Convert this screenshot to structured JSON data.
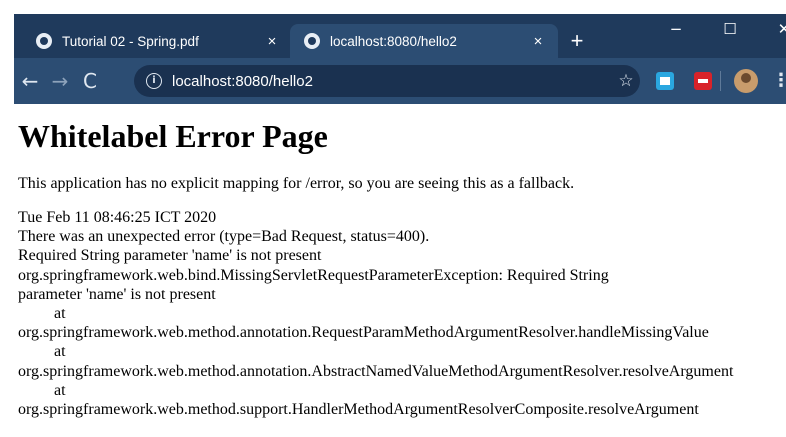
{
  "browser": {
    "tabs": [
      {
        "title": "Tutorial 02 - Spring.pdf",
        "close": "×",
        "active": false
      },
      {
        "title": "localhost:8080/hello2",
        "close": "×",
        "active": true
      }
    ],
    "new_tab": "+",
    "window_controls": {
      "minimize": "−",
      "maximize": "☐",
      "close": "✕"
    },
    "nav": {
      "back": "←",
      "forward": "→",
      "reload": "C"
    },
    "address_bar": {
      "info": "i",
      "url": "localhost:8080/hello2",
      "star": "☆"
    },
    "menu": "⋮",
    "colors": {
      "frame": "#1f3a5c",
      "toolbar": "#2c4d73",
      "omnibox": "#1a3150"
    }
  },
  "page": {
    "title": "Whitelabel Error Page",
    "description": "This application has no explicit mapping for /error, so you are seeing this as a fallback.",
    "timestamp": "Tue Feb 11 08:46:25 ICT 2020",
    "error_summary": "There was an unexpected error (type=Bad Request, status=400).",
    "message": "Required String parameter 'name' is not present",
    "trace": [
      "org.springframework.web.bind.MissingServletRequestParameterException: Required String",
      "parameter 'name' is not present",
      "at",
      "org.springframework.web.method.annotation.RequestParamMethodArgumentResolver.handleMissingValue",
      "at",
      "org.springframework.web.method.annotation.AbstractNamedValueMethodArgumentResolver.resolveArgument",
      "at",
      "org.springframework.web.method.support.HandlerMethodArgumentResolverComposite.resolveArgument"
    ]
  }
}
